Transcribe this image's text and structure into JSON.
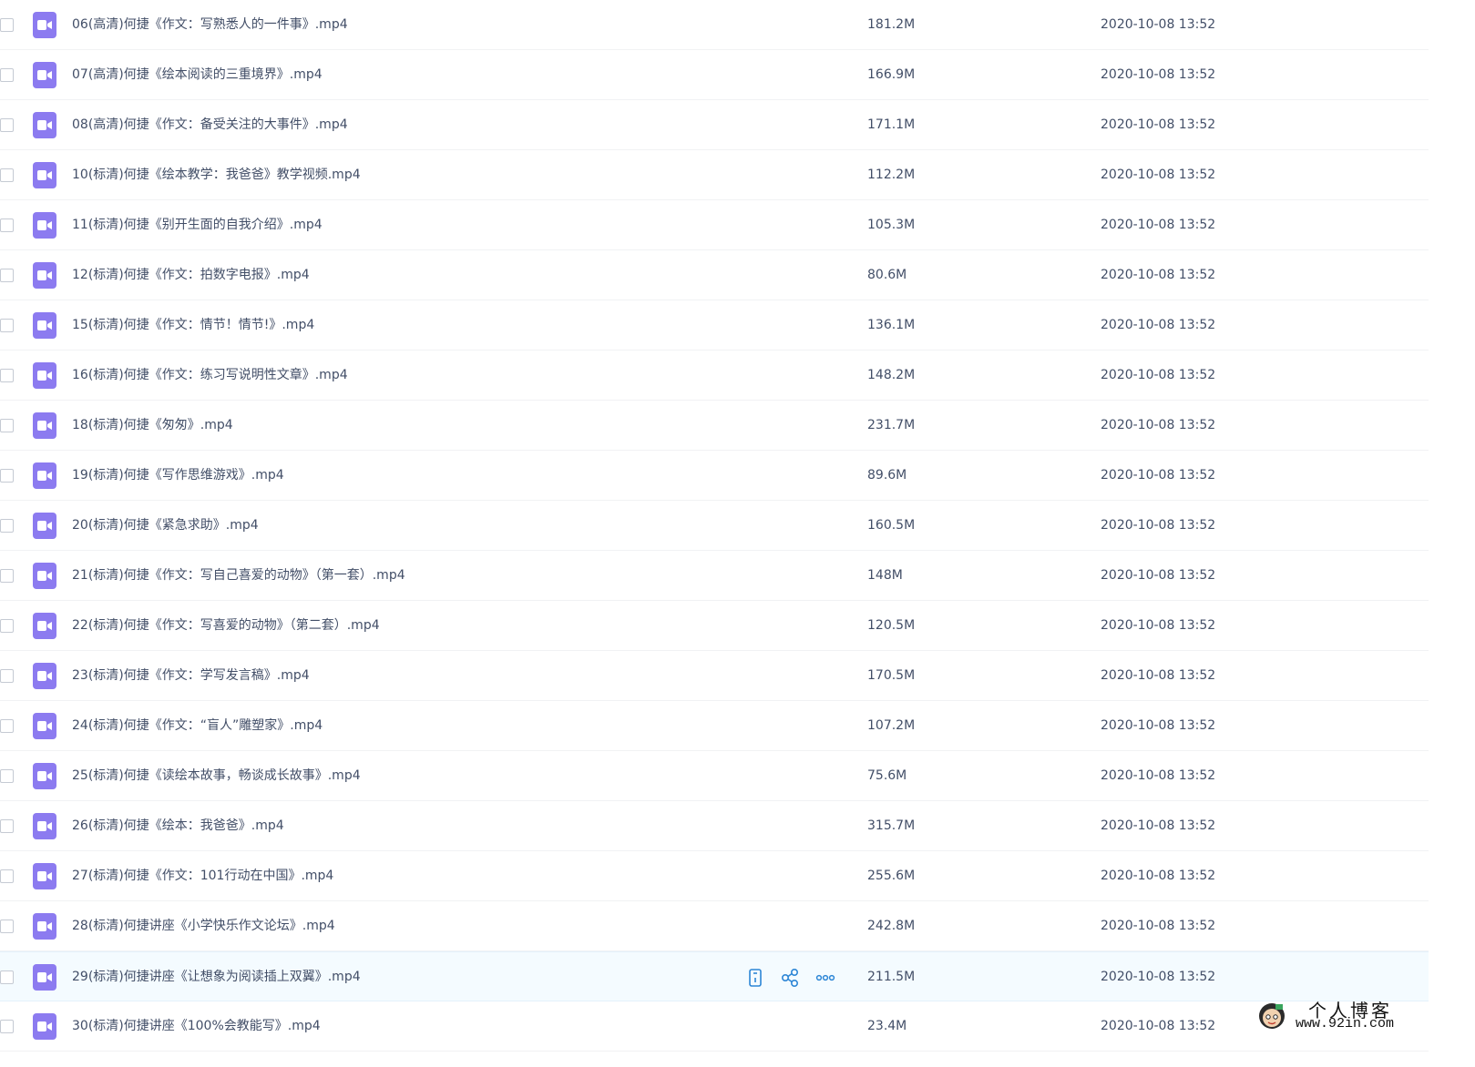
{
  "files": [
    {
      "name": "06(高清)何捷《作文：写熟悉人的一件事》.mp4",
      "size": "181.2M",
      "date": "2020-10-08 13:52"
    },
    {
      "name": "07(高清)何捷《绘本阅读的三重境界》.mp4",
      "size": "166.9M",
      "date": "2020-10-08 13:52"
    },
    {
      "name": "08(高清)何捷《作文：备受关注的大事件》.mp4",
      "size": "171.1M",
      "date": "2020-10-08 13:52"
    },
    {
      "name": "10(标清)何捷《绘本教学：我爸爸》教学视频.mp4",
      "size": "112.2M",
      "date": "2020-10-08 13:52"
    },
    {
      "name": "11(标清)何捷《别开生面的自我介绍》.mp4",
      "size": "105.3M",
      "date": "2020-10-08 13:52"
    },
    {
      "name": "12(标清)何捷《作文：拍数字电报》.mp4",
      "size": "80.6M",
      "date": "2020-10-08 13:52"
    },
    {
      "name": "15(标清)何捷《作文：情节！情节!》.mp4",
      "size": "136.1M",
      "date": "2020-10-08 13:52"
    },
    {
      "name": "16(标清)何捷《作文：练习写说明性文章》.mp4",
      "size": "148.2M",
      "date": "2020-10-08 13:52"
    },
    {
      "name": "18(标清)何捷《匆匆》.mp4",
      "size": "231.7M",
      "date": "2020-10-08 13:52"
    },
    {
      "name": "19(标清)何捷《写作思维游戏》.mp4",
      "size": "89.6M",
      "date": "2020-10-08 13:52"
    },
    {
      "name": "20(标清)何捷《紧急求助》.mp4",
      "size": "160.5M",
      "date": "2020-10-08 13:52"
    },
    {
      "name": "21(标清)何捷《作文：写自己喜爱的动物》（第一套）.mp4",
      "size": "148M",
      "date": "2020-10-08 13:52"
    },
    {
      "name": "22(标清)何捷《作文：写喜爱的动物》（第二套）.mp4",
      "size": "120.5M",
      "date": "2020-10-08 13:52"
    },
    {
      "name": "23(标清)何捷《作文：学写发言稿》.mp4",
      "size": "170.5M",
      "date": "2020-10-08 13:52"
    },
    {
      "name": "24(标清)何捷《作文：“盲人”雕塑家》.mp4",
      "size": "107.2M",
      "date": "2020-10-08 13:52"
    },
    {
      "name": "25(标清)何捷《读绘本故事，畅谈成长故事》.mp4",
      "size": "75.6M",
      "date": "2020-10-08 13:52"
    },
    {
      "name": "26(标清)何捷《绘本：我爸爸》.mp4",
      "size": "315.7M",
      "date": "2020-10-08 13:52"
    },
    {
      "name": "27(标清)何捷《作文：101行动在中国》.mp4",
      "size": "255.6M",
      "date": "2020-10-08 13:52"
    },
    {
      "name": "28(标清)何捷讲座《小学快乐作文论坛》.mp4",
      "size": "242.8M",
      "date": "2020-10-08 13:52"
    },
    {
      "name": "29(标清)何捷讲座《让想象为阅读插上双翼》.mp4",
      "size": "211.5M",
      "date": "2020-10-08 13:52",
      "hovered": true
    },
    {
      "name": "30(标清)何捷讲座《100%会教能写》.mp4",
      "size": "23.4M",
      "date": "2020-10-08 13:52"
    }
  ],
  "row_actions": [
    {
      "icon": "phone-icon"
    },
    {
      "icon": "share-icon"
    },
    {
      "icon": "more-icon"
    }
  ],
  "file_icon": "video-file-icon",
  "colors": {
    "file_icon_bg": "#8c7bf0",
    "action_icon": "#2d86d6",
    "hover_row_bg": "#f4fbff",
    "text": "#424e67"
  },
  "watermark": {
    "title": "个人博客",
    "url": "www.92in.com"
  }
}
